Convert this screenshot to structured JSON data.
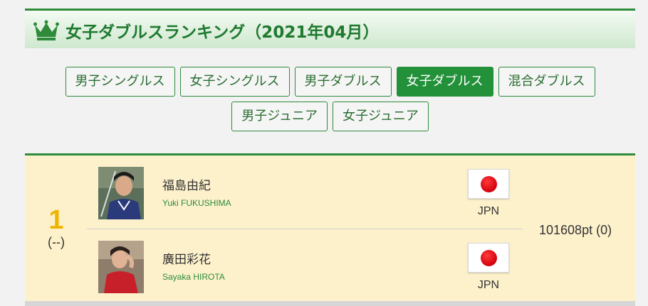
{
  "header": {
    "title": "女子ダブルスランキング（2021年04月）",
    "crown_icon": "crown-icon",
    "accent_color": "#2e8b3a"
  },
  "tabs": [
    {
      "label": "男子シングルス",
      "active": false
    },
    {
      "label": "女子シングルス",
      "active": false
    },
    {
      "label": "男子ダブルス",
      "active": false
    },
    {
      "label": "女子ダブルス",
      "active": true
    },
    {
      "label": "混合ダブルス",
      "active": false
    },
    {
      "label": "男子ジュニア",
      "active": false
    },
    {
      "label": "女子ジュニア",
      "active": false
    }
  ],
  "ranking": {
    "rank": "1",
    "change": "(--)",
    "points": "101608pt (0)",
    "players": [
      {
        "name_jp": "福島由紀",
        "name_en": "Yuki FUKUSHIMA",
        "country": "JPN",
        "flag": "japan-flag"
      },
      {
        "name_jp": "廣田彩花",
        "name_en": "Sayaka HIROTA",
        "country": "JPN",
        "flag": "japan-flag"
      }
    ]
  }
}
